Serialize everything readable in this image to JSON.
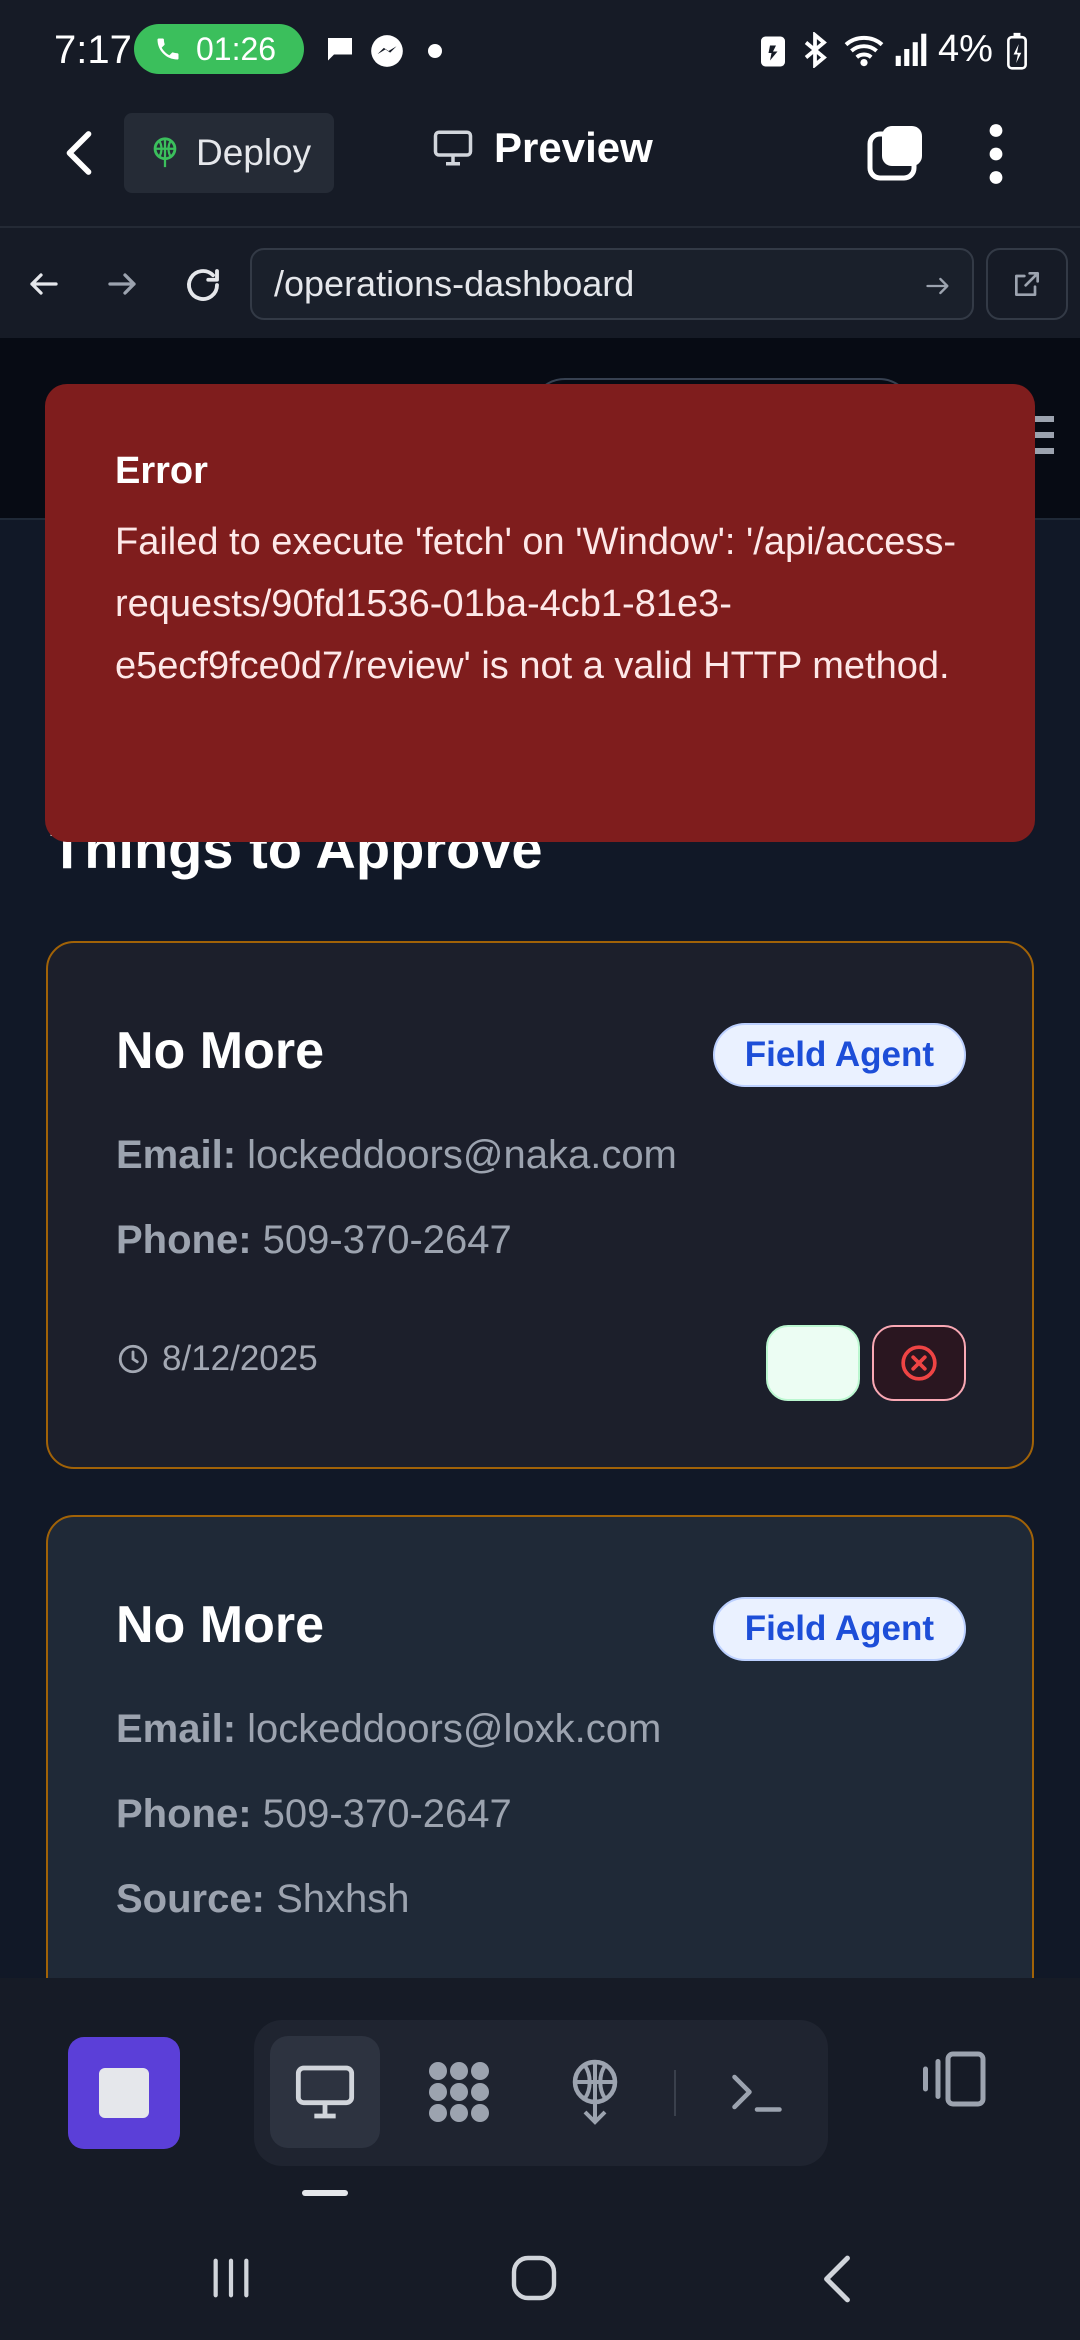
{
  "status_bar": {
    "time": "7:17",
    "call_timer": "01:26",
    "battery": "4%",
    "icons": [
      "call-icon",
      "chat-bubble-icon",
      "messenger-icon",
      "dot-icon",
      "battery-saver-icon",
      "bluetooth-icon",
      "wifi-icon",
      "signal-icon",
      "battery-charging-icon"
    ]
  },
  "app_header": {
    "deploy_label": "Deploy",
    "preview_label": "Preview"
  },
  "url_bar": {
    "url": "/operations-dashboard"
  },
  "section": {
    "title": "Things to Approve"
  },
  "error": {
    "title": "Error",
    "message": "Failed to execute 'fetch' on 'Window': '/api/access-requests/90fd1536-01ba-4cb1-81e3-e5ecf9fce0d7/review' is not a valid HTTP method."
  },
  "cards": [
    {
      "name": "No More",
      "role": "Field Agent",
      "email_label": "Email:",
      "email": "lockeddoors@naka.com",
      "phone_label": "Phone:",
      "phone": "509-370-2647",
      "date": "8/12/2025"
    },
    {
      "name": "No More",
      "role": "Field Agent",
      "email_label": "Email:",
      "email": "lockeddoors@loxk.com",
      "phone_label": "Phone:",
      "phone": "509-370-2647",
      "source_label": "Source:",
      "source": "Shxhsh"
    }
  ],
  "colors": {
    "error_bg": "#7f1d1d",
    "card_border": "#a16207",
    "badge_text": "#1d4ed8",
    "fab": "#2196f3",
    "stop_button": "#5b3fd8"
  }
}
